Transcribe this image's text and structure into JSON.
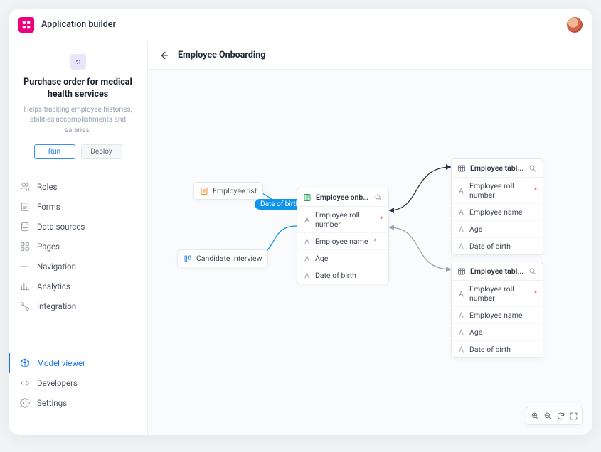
{
  "app": {
    "title": "Application builder"
  },
  "project": {
    "title": "Purchase order for medical health services",
    "description": "Helps tracking employee histories, abilities,accomplishments and salaries.",
    "run_label": "Run",
    "deploy_label": "Deploy"
  },
  "sidebar": {
    "items": [
      {
        "icon": "users-icon",
        "label": "Roles"
      },
      {
        "icon": "form-icon",
        "label": "Forms"
      },
      {
        "icon": "database-icon",
        "label": "Data sources"
      },
      {
        "icon": "grid-icon",
        "label": "Pages"
      },
      {
        "icon": "nav-icon",
        "label": "Navigation"
      },
      {
        "icon": "chart-icon",
        "label": "Analytics"
      },
      {
        "icon": "integration-icon",
        "label": "Integration"
      }
    ],
    "items2": [
      {
        "icon": "cube-icon",
        "label": "Model viewer",
        "active": true
      },
      {
        "icon": "code-icon",
        "label": "Developers"
      },
      {
        "icon": "gear-icon",
        "label": "Settings"
      }
    ]
  },
  "page": {
    "title": "Employee Onboarding"
  },
  "canvas": {
    "employee_list_chip": "Employee list",
    "candidate_chip": "Candidate Interview",
    "pill": "Date of birth",
    "onboarding_node": {
      "title": "Employee onboard...",
      "fields": [
        {
          "label": "Employee roll number",
          "required": true
        },
        {
          "label": "Employee name",
          "required": true
        },
        {
          "label": "Age",
          "required": false
        },
        {
          "label": "Date of birth",
          "required": false
        }
      ]
    },
    "table_node_1": {
      "title": "Employee tabl...",
      "fields": [
        {
          "label": "Employee roll number",
          "required": true
        },
        {
          "label": "Employee name",
          "required": false
        },
        {
          "label": "Age",
          "required": false
        },
        {
          "label": "Date of birth",
          "required": false
        }
      ]
    },
    "table_node_2": {
      "title": "Employee tabl...",
      "fields": [
        {
          "label": "Employee roll number",
          "required": true
        },
        {
          "label": "Employee name",
          "required": false
        },
        {
          "label": "Age",
          "required": false
        },
        {
          "label": "Date of birth",
          "required": false
        }
      ]
    }
  }
}
